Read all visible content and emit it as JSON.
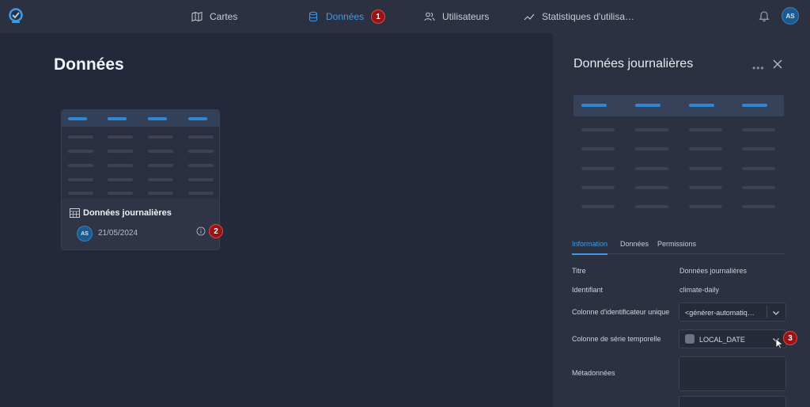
{
  "nav": {
    "items": [
      {
        "label": "Cartes",
        "icon": "map-icon"
      },
      {
        "label": "Données",
        "icon": "database-icon",
        "active": true,
        "badge": "1"
      },
      {
        "label": "Utilisateurs",
        "icon": "users-icon"
      },
      {
        "label": "Statistiques d'utilisa…",
        "icon": "trending-icon"
      }
    ],
    "user_initials": "AS"
  },
  "main": {
    "title": "Données",
    "card": {
      "name": "Données journalières",
      "owner_initials": "AS",
      "date": "21/05/2024",
      "badge": "2"
    }
  },
  "panel": {
    "title": "Données journalières",
    "more": "•••",
    "tabs": [
      {
        "label": "Information",
        "active": true
      },
      {
        "label": "Données"
      },
      {
        "label": "Permissions"
      }
    ],
    "fields": {
      "title_label": "Titre",
      "title_value": "Données journalières",
      "id_label": "Identifiant",
      "id_value": "climate-daily",
      "unique_label": "Colonne d'identificateur unique",
      "unique_value": "<générer-automatiq…",
      "timeseries_label": "Colonne de série temporelle",
      "timeseries_value": "LOCAL_DATE",
      "timeseries_badge": "3",
      "metadata_label": "Métadonnées"
    }
  },
  "colors": {
    "accent": "#3f9be8",
    "badge": "#9b1212",
    "background": "#23283a",
    "panel": "#2c3142"
  }
}
